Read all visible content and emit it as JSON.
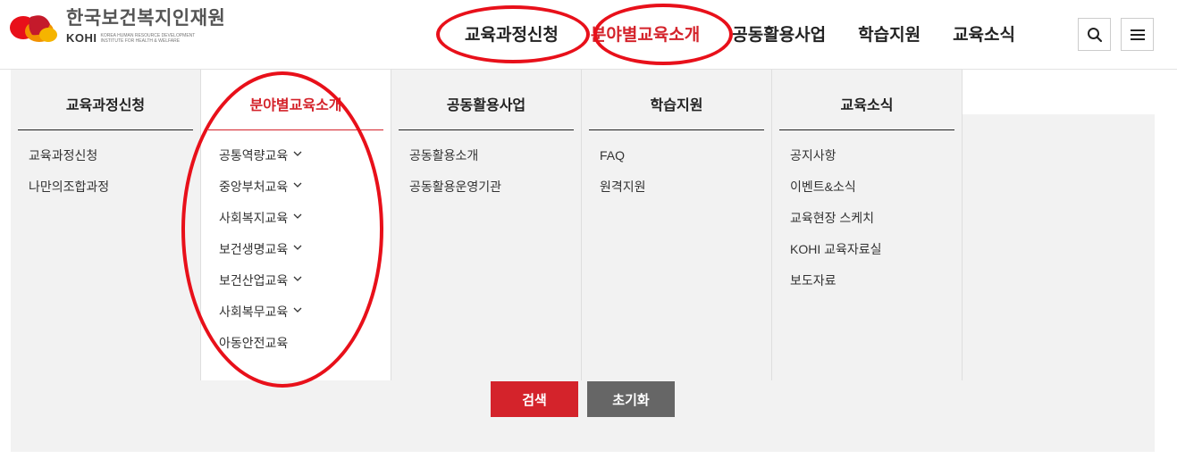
{
  "header": {
    "logo_kr": "한국보건복지인재원",
    "logo_en": "KOHI",
    "logo_sub": "KOREA HUMAN RESOURCE DEVELOPMENT INSTITUTE FOR HEALTH & WELFARE",
    "nav": [
      {
        "label": "교육과정신청"
      },
      {
        "label": "분야별교육소개"
      },
      {
        "label": "공동활용사업"
      },
      {
        "label": "학습지원"
      },
      {
        "label": "교육소식"
      }
    ],
    "search_icon": "search-icon",
    "menu_icon": "hamburger-menu-icon"
  },
  "mega_menu": {
    "columns": [
      {
        "title": "교육과정신청",
        "items": [
          "교육과정신청",
          "나만의조합과정"
        ]
      },
      {
        "title": "분야별교육소개",
        "items": [
          "공통역량교육",
          "중앙부처교육",
          "사회복지교육",
          "보건생명교육",
          "보건산업교육",
          "사회복무교육",
          "아동안전교육"
        ]
      },
      {
        "title": "공동활용사업",
        "items": [
          "공동활용소개",
          "공동활용운영기관"
        ]
      },
      {
        "title": "학습지원",
        "items": [
          "FAQ",
          "원격지원"
        ]
      },
      {
        "title": "교육소식",
        "items": [
          "공지사항",
          "이벤트&소식",
          "교육현장 스케치",
          "KOHI 교육자료실",
          "보도자료"
        ]
      }
    ]
  },
  "buttons": {
    "search": "검색",
    "reset": "초기화"
  },
  "colors": {
    "accent": "#d4232b",
    "annotation": "#e8101a",
    "reset_button": "#666666",
    "panel_bg": "#f2f2f2"
  }
}
